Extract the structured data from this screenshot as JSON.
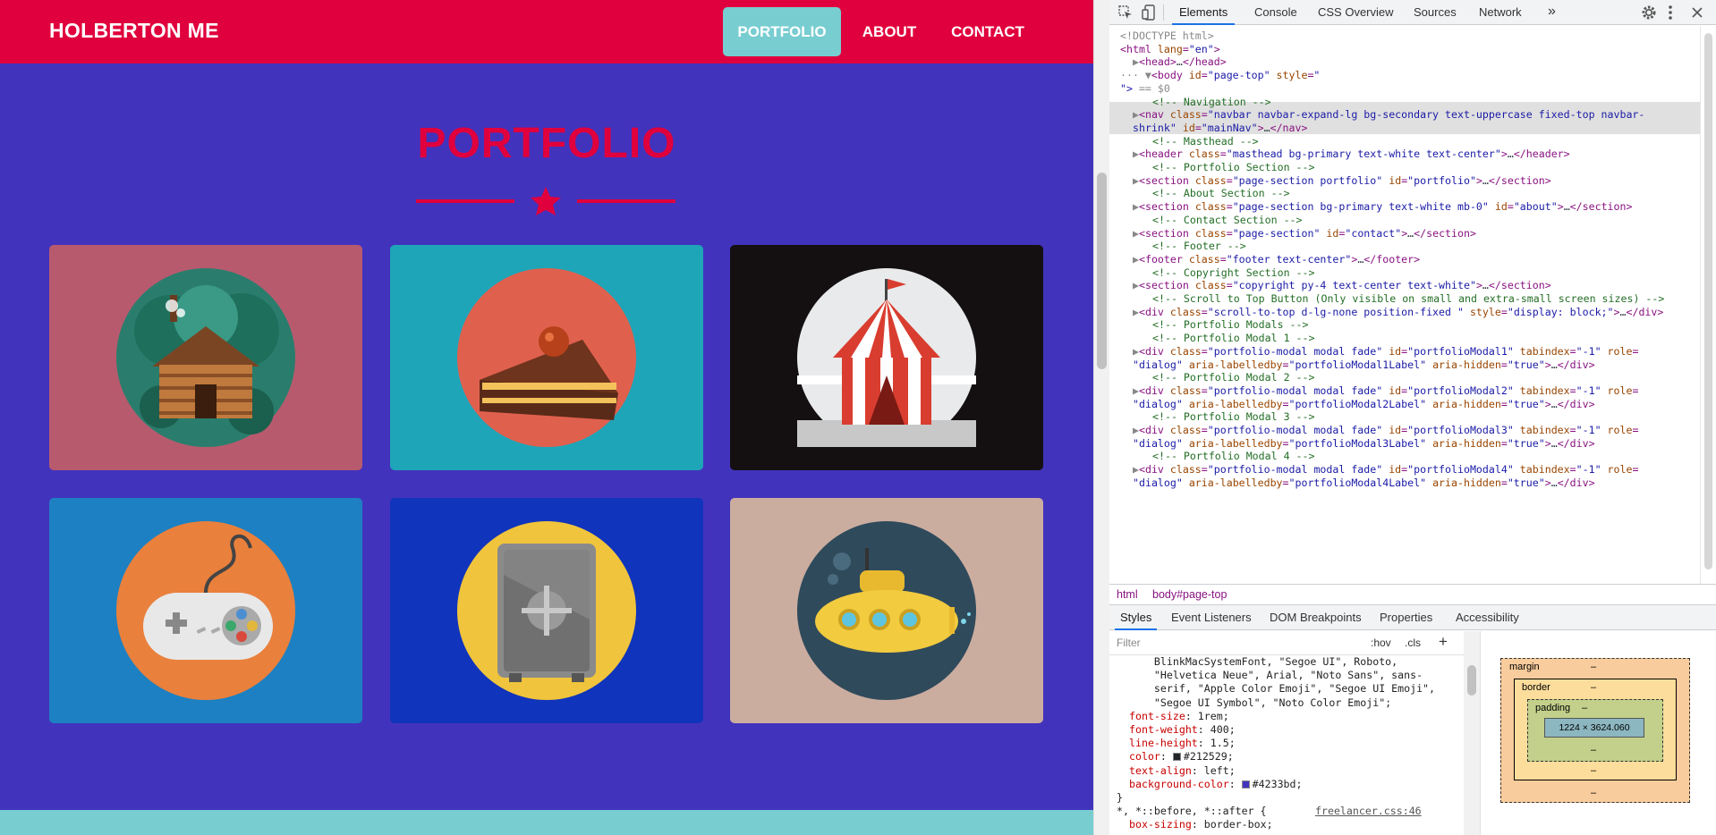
{
  "site": {
    "brand": "HOLBERTON ME",
    "nav": [
      {
        "label": "PORTFOLIO",
        "active": true
      },
      {
        "label": "ABOUT",
        "active": false
      },
      {
        "label": "CONTACT",
        "active": false
      }
    ],
    "heading": "PORTFOLIO",
    "colors": {
      "primary": "#4233bd",
      "secondary": "#e0003d",
      "accent": "#78cdd1"
    },
    "tiles": [
      {
        "name": "cabin",
        "bg": "#b85a6e",
        "icon": "log-cabin-icon"
      },
      {
        "name": "cake",
        "bg": "#1ea5b8",
        "icon": "cake-slice-icon"
      },
      {
        "name": "circus",
        "bg": "#141011",
        "icon": "circus-tent-icon"
      },
      {
        "name": "game",
        "bg": "#1d80c2",
        "icon": "game-controller-icon"
      },
      {
        "name": "safe",
        "bg": "#1034bb",
        "icon": "safe-icon"
      },
      {
        "name": "submarine",
        "bg": "#cbada0",
        "icon": "submarine-icon"
      }
    ]
  },
  "devtools": {
    "tabs": [
      "Elements",
      "Console",
      "CSS Overview",
      "Sources",
      "Network"
    ],
    "more": "»",
    "breadcrumbs": [
      "html",
      "body#page-top"
    ],
    "style_tabs": [
      "Styles",
      "Event Listeners",
      "DOM Breakpoints",
      "Properties",
      "Accessibility"
    ],
    "filter_placeholder": "Filter",
    "hov": ":hov",
    "cls": ".cls",
    "plus": "+",
    "box_model": {
      "margin": "margin",
      "border": "border",
      "padding": "padding",
      "dash": "–",
      "content": "1224 × 3624.060"
    },
    "dom_lines": [
      {
        "indent": 0,
        "parts": [
          [
            "gr",
            "<!DOCTYPE html>"
          ]
        ]
      },
      {
        "indent": 0,
        "parts": [
          [
            "tag",
            "<html "
          ],
          [
            "an",
            "lang"
          ],
          [
            "tag",
            "="
          ],
          [
            "av",
            "\"en\""
          ],
          [
            "tag",
            ">"
          ]
        ]
      },
      {
        "indent": 1,
        "parts": [
          [
            "gr",
            "▶"
          ],
          [
            "tag",
            "<head>"
          ],
          [
            "tx",
            "…"
          ],
          [
            "tag",
            "</head>"
          ]
        ]
      },
      {
        "indent": 0,
        "parts": [
          [
            "gr",
            "··· ▼"
          ],
          [
            "tag",
            "<body "
          ],
          [
            "an",
            "id"
          ],
          [
            "tag",
            "="
          ],
          [
            "av",
            "\"page-top\" "
          ],
          [
            "an",
            "style"
          ],
          [
            "tag",
            "="
          ],
          [
            "av",
            "\""
          ]
        ]
      },
      {
        "indent": 0,
        "parts": [
          [
            "av",
            "\"> "
          ],
          [
            "gr",
            "== $0"
          ]
        ]
      },
      {
        "indent": 2,
        "parts": [
          [
            "cmt",
            "<!-- Navigation -->"
          ]
        ]
      },
      {
        "indent": 1,
        "parts": [
          [
            "gr",
            "▶"
          ],
          [
            "tag",
            "<nav "
          ],
          [
            "an",
            "class"
          ],
          [
            "tag",
            "="
          ],
          [
            "av",
            "\"navbar navbar-expand-lg bg-secondary text-uppercase fixed-top navbar-"
          ]
        ]
      },
      {
        "indent": 1,
        "parts": [
          [
            "av",
            "shrink\" "
          ],
          [
            "an",
            "id"
          ],
          [
            "tag",
            "="
          ],
          [
            "av",
            "\"mainNav\""
          ],
          [
            "tag",
            ">"
          ],
          [
            "tx",
            "…"
          ],
          [
            "tag",
            "</nav>"
          ]
        ]
      },
      {
        "indent": 2,
        "parts": [
          [
            "cmt",
            "<!-- Masthead -->"
          ]
        ]
      },
      {
        "indent": 1,
        "parts": [
          [
            "gr",
            "▶"
          ],
          [
            "tag",
            "<header "
          ],
          [
            "an",
            "class"
          ],
          [
            "tag",
            "="
          ],
          [
            "av",
            "\"masthead bg-primary text-white text-center\""
          ],
          [
            "tag",
            ">"
          ],
          [
            "tx",
            "…"
          ],
          [
            "tag",
            "</header>"
          ]
        ]
      },
      {
        "indent": 2,
        "parts": [
          [
            "cmt",
            "<!-- Portfolio Section -->"
          ]
        ]
      },
      {
        "indent": 1,
        "parts": [
          [
            "gr",
            "▶"
          ],
          [
            "tag",
            "<section "
          ],
          [
            "an",
            "class"
          ],
          [
            "tag",
            "="
          ],
          [
            "av",
            "\"page-section portfolio\" "
          ],
          [
            "an",
            "id"
          ],
          [
            "tag",
            "="
          ],
          [
            "av",
            "\"portfolio\""
          ],
          [
            "tag",
            ">"
          ],
          [
            "tx",
            "…"
          ],
          [
            "tag",
            "</section>"
          ]
        ]
      },
      {
        "indent": 2,
        "parts": [
          [
            "cmt",
            "<!-- About Section -->"
          ]
        ]
      },
      {
        "indent": 1,
        "parts": [
          [
            "gr",
            "▶"
          ],
          [
            "tag",
            "<section "
          ],
          [
            "an",
            "class"
          ],
          [
            "tag",
            "="
          ],
          [
            "av",
            "\"page-section bg-primary text-white mb-0\" "
          ],
          [
            "an",
            "id"
          ],
          [
            "tag",
            "="
          ],
          [
            "av",
            "\"about\""
          ],
          [
            "tag",
            ">"
          ],
          [
            "tx",
            "…"
          ],
          [
            "tag",
            "</section>"
          ]
        ]
      },
      {
        "indent": 2,
        "parts": [
          [
            "cmt",
            "<!-- Contact Section -->"
          ]
        ]
      },
      {
        "indent": 1,
        "parts": [
          [
            "gr",
            "▶"
          ],
          [
            "tag",
            "<section "
          ],
          [
            "an",
            "class"
          ],
          [
            "tag",
            "="
          ],
          [
            "av",
            "\"page-section\" "
          ],
          [
            "an",
            "id"
          ],
          [
            "tag",
            "="
          ],
          [
            "av",
            "\"contact\""
          ],
          [
            "tag",
            ">"
          ],
          [
            "tx",
            "…"
          ],
          [
            "tag",
            "</section>"
          ]
        ]
      },
      {
        "indent": 2,
        "parts": [
          [
            "cmt",
            "<!-- Footer -->"
          ]
        ]
      },
      {
        "indent": 1,
        "parts": [
          [
            "gr",
            "▶"
          ],
          [
            "tag",
            "<footer "
          ],
          [
            "an",
            "class"
          ],
          [
            "tag",
            "="
          ],
          [
            "av",
            "\"footer text-center\""
          ],
          [
            "tag",
            ">"
          ],
          [
            "tx",
            "…"
          ],
          [
            "tag",
            "</footer>"
          ]
        ]
      },
      {
        "indent": 2,
        "parts": [
          [
            "cmt",
            "<!-- Copyright Section -->"
          ]
        ]
      },
      {
        "indent": 1,
        "parts": [
          [
            "gr",
            "▶"
          ],
          [
            "tag",
            "<section "
          ],
          [
            "an",
            "class"
          ],
          [
            "tag",
            "="
          ],
          [
            "av",
            "\"copyright py-4 text-center text-white\""
          ],
          [
            "tag",
            ">"
          ],
          [
            "tx",
            "…"
          ],
          [
            "tag",
            "</section>"
          ]
        ]
      },
      {
        "indent": 2,
        "parts": [
          [
            "cmt",
            "<!-- Scroll to Top Button (Only visible on small and extra-small screen sizes) -->"
          ]
        ]
      },
      {
        "indent": 1,
        "parts": [
          [
            "gr",
            "▶"
          ],
          [
            "tag",
            "<div "
          ],
          [
            "an",
            "class"
          ],
          [
            "tag",
            "="
          ],
          [
            "av",
            "\"scroll-to-top d-lg-none position-fixed \" "
          ],
          [
            "an",
            "style"
          ],
          [
            "tag",
            "="
          ],
          [
            "av",
            "\"display: block;\""
          ],
          [
            "tag",
            ">"
          ],
          [
            "tx",
            "…"
          ],
          [
            "tag",
            "</div>"
          ]
        ]
      },
      {
        "indent": 2,
        "parts": [
          [
            "cmt",
            "<!-- Portfolio Modals -->"
          ]
        ]
      },
      {
        "indent": 2,
        "parts": [
          [
            "cmt",
            "<!-- Portfolio Modal 1 -->"
          ]
        ]
      },
      {
        "indent": 1,
        "parts": [
          [
            "gr",
            "▶"
          ],
          [
            "tag",
            "<div "
          ],
          [
            "an",
            "class"
          ],
          [
            "tag",
            "="
          ],
          [
            "av",
            "\"portfolio-modal modal fade\" "
          ],
          [
            "an",
            "id"
          ],
          [
            "tag",
            "="
          ],
          [
            "av",
            "\"portfolioModal1\" "
          ],
          [
            "an",
            "tabindex"
          ],
          [
            "tag",
            "="
          ],
          [
            "av",
            "\"-1\" "
          ],
          [
            "an",
            "role"
          ],
          [
            "tag",
            "="
          ]
        ]
      },
      {
        "indent": 1,
        "parts": [
          [
            "av",
            "\"dialog\" "
          ],
          [
            "an",
            "aria-labelledby"
          ],
          [
            "tag",
            "="
          ],
          [
            "av",
            "\"portfolioModal1Label\" "
          ],
          [
            "an",
            "aria-hidden"
          ],
          [
            "tag",
            "="
          ],
          [
            "av",
            "\"true\""
          ],
          [
            "tag",
            ">"
          ],
          [
            "tx",
            "…"
          ],
          [
            "tag",
            "</div>"
          ]
        ]
      },
      {
        "indent": 2,
        "parts": [
          [
            "cmt",
            "<!-- Portfolio Modal 2 -->"
          ]
        ]
      },
      {
        "indent": 1,
        "parts": [
          [
            "gr",
            "▶"
          ],
          [
            "tag",
            "<div "
          ],
          [
            "an",
            "class"
          ],
          [
            "tag",
            "="
          ],
          [
            "av",
            "\"portfolio-modal modal fade\" "
          ],
          [
            "an",
            "id"
          ],
          [
            "tag",
            "="
          ],
          [
            "av",
            "\"portfolioModal2\" "
          ],
          [
            "an",
            "tabindex"
          ],
          [
            "tag",
            "="
          ],
          [
            "av",
            "\"-1\" "
          ],
          [
            "an",
            "role"
          ],
          [
            "tag",
            "="
          ]
        ]
      },
      {
        "indent": 1,
        "parts": [
          [
            "av",
            "\"dialog\" "
          ],
          [
            "an",
            "aria-labelledby"
          ],
          [
            "tag",
            "="
          ],
          [
            "av",
            "\"portfolioModal2Label\" "
          ],
          [
            "an",
            "aria-hidden"
          ],
          [
            "tag",
            "="
          ],
          [
            "av",
            "\"true\""
          ],
          [
            "tag",
            ">"
          ],
          [
            "tx",
            "…"
          ],
          [
            "tag",
            "</div>"
          ]
        ]
      },
      {
        "indent": 2,
        "parts": [
          [
            "cmt",
            "<!-- Portfolio Modal 3 -->"
          ]
        ]
      },
      {
        "indent": 1,
        "parts": [
          [
            "gr",
            "▶"
          ],
          [
            "tag",
            "<div "
          ],
          [
            "an",
            "class"
          ],
          [
            "tag",
            "="
          ],
          [
            "av",
            "\"portfolio-modal modal fade\" "
          ],
          [
            "an",
            "id"
          ],
          [
            "tag",
            "="
          ],
          [
            "av",
            "\"portfolioModal3\" "
          ],
          [
            "an",
            "tabindex"
          ],
          [
            "tag",
            "="
          ],
          [
            "av",
            "\"-1\" "
          ],
          [
            "an",
            "role"
          ],
          [
            "tag",
            "="
          ]
        ]
      },
      {
        "indent": 1,
        "parts": [
          [
            "av",
            "\"dialog\" "
          ],
          [
            "an",
            "aria-labelledby"
          ],
          [
            "tag",
            "="
          ],
          [
            "av",
            "\"portfolioModal3Label\" "
          ],
          [
            "an",
            "aria-hidden"
          ],
          [
            "tag",
            "="
          ],
          [
            "av",
            "\"true\""
          ],
          [
            "tag",
            ">"
          ],
          [
            "tx",
            "…"
          ],
          [
            "tag",
            "</div>"
          ]
        ]
      },
      {
        "indent": 2,
        "parts": [
          [
            "cmt",
            "<!-- Portfolio Modal 4 -->"
          ]
        ]
      },
      {
        "indent": 1,
        "parts": [
          [
            "gr",
            "▶"
          ],
          [
            "tag",
            "<div "
          ],
          [
            "an",
            "class"
          ],
          [
            "tag",
            "="
          ],
          [
            "av",
            "\"portfolio-modal modal fade\" "
          ],
          [
            "an",
            "id"
          ],
          [
            "tag",
            "="
          ],
          [
            "av",
            "\"portfolioModal4\" "
          ],
          [
            "an",
            "tabindex"
          ],
          [
            "tag",
            "="
          ],
          [
            "av",
            "\"-1\" "
          ],
          [
            "an",
            "role"
          ],
          [
            "tag",
            "="
          ]
        ]
      },
      {
        "indent": 1,
        "parts": [
          [
            "av",
            "\"dialog\" "
          ],
          [
            "an",
            "aria-labelledby"
          ],
          [
            "tag",
            "="
          ],
          [
            "av",
            "\"portfolioModal4Label\" "
          ],
          [
            "an",
            "aria-hidden"
          ],
          [
            "tag",
            "="
          ],
          [
            "av",
            "\"true\""
          ],
          [
            "tag",
            ">"
          ],
          [
            "tx",
            "…"
          ],
          [
            "tag",
            "</div>"
          ]
        ]
      }
    ],
    "style_lines": [
      {
        "kind": "val",
        "text": "    BlinkMacSystemFont, \"Segoe UI\", Roboto,"
      },
      {
        "kind": "val",
        "text": "    \"Helvetica Neue\", Arial, \"Noto Sans\", sans-"
      },
      {
        "kind": "val",
        "text": "    serif, \"Apple Color Emoji\", \"Segoe UI Emoji\","
      },
      {
        "kind": "val",
        "text": "    \"Segoe UI Symbol\", \"Noto Color Emoji\";"
      },
      {
        "kind": "prop",
        "name": "font-size",
        "value": "1rem;"
      },
      {
        "kind": "prop",
        "name": "font-weight",
        "value": "400;"
      },
      {
        "kind": "prop",
        "name": "line-height",
        "value": "1.5;"
      },
      {
        "kind": "prop",
        "name": "color",
        "value": "#212529;",
        "swatch": "#212529"
      },
      {
        "kind": "prop",
        "name": "text-align",
        "value": "left;"
      },
      {
        "kind": "prop",
        "name": "background-color",
        "value": "#4233bd;",
        "swatch": "#4233bd"
      },
      {
        "kind": "val",
        "text": "}"
      },
      {
        "kind": "sel",
        "text": "*, *::before, *::after {",
        "source": "freelancer.css:46"
      },
      {
        "kind": "prop",
        "name": "box-sizing",
        "value": "border-box;"
      }
    ]
  }
}
